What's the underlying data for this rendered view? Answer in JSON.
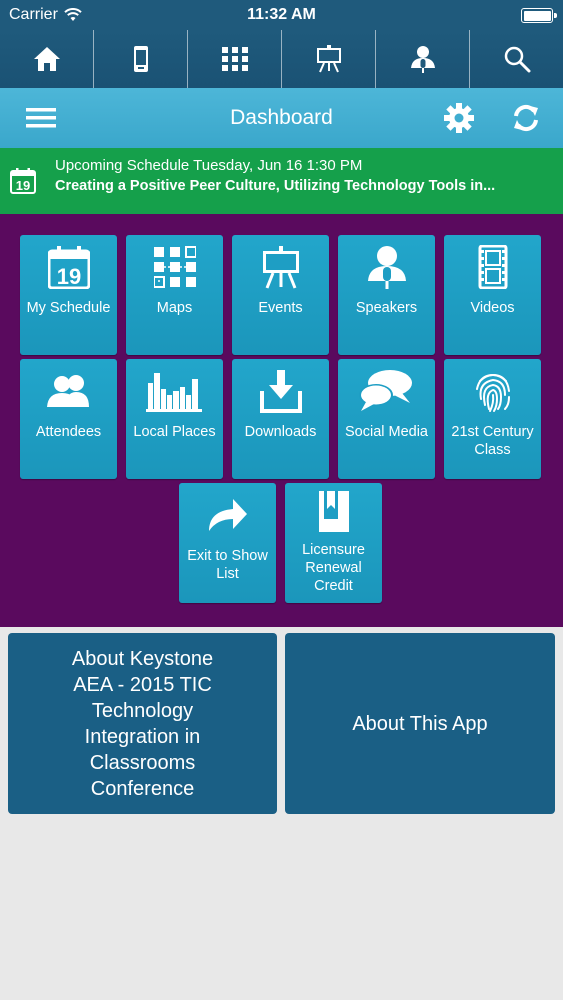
{
  "status_bar": {
    "carrier": "Carrier",
    "time": "11:32 AM"
  },
  "top_nav": [
    {
      "icon": "home-icon"
    },
    {
      "icon": "phone-icon"
    },
    {
      "icon": "map-grid-icon"
    },
    {
      "icon": "easel-icon"
    },
    {
      "icon": "speaker-icon"
    },
    {
      "icon": "search-icon"
    }
  ],
  "title_bar": {
    "title": "Dashboard"
  },
  "banner": {
    "day": "19",
    "line1": "Upcoming Schedule Tuesday, Jun 16 1:30 PM",
    "line2": "Creating a Positive Peer Culture, Utilizing Technology Tools in..."
  },
  "tiles": [
    {
      "label": "My Schedule",
      "icon": "calendar-icon",
      "day": "19"
    },
    {
      "label": "Maps",
      "icon": "map-grid-icon"
    },
    {
      "label": "Events",
      "icon": "easel-icon"
    },
    {
      "label": "Speakers",
      "icon": "speaker-icon"
    },
    {
      "label": "Videos",
      "icon": "film-icon"
    },
    {
      "label": "Attendees",
      "icon": "people-icon"
    },
    {
      "label": "Local Places",
      "icon": "city-icon"
    },
    {
      "label": "Downloads",
      "icon": "download-icon"
    },
    {
      "label": "Social Media",
      "icon": "chat-bubbles-icon"
    },
    {
      "label": "21st Century Class",
      "icon": "fingerprint-icon"
    },
    {
      "label": "Exit to Show List",
      "icon": "share-arrow-icon"
    },
    {
      "label": "Licensure Renewal Credit",
      "icon": "book-icon"
    }
  ],
  "info_buttons": [
    {
      "label": "About Keystone AEA - 2015 TIC Technology Integration in Classrooms Conference"
    },
    {
      "label": "About This App"
    }
  ],
  "colors": {
    "status_bar": "#1f5a7c",
    "title_bar": "#3aa7cb",
    "banner": "#15a04b",
    "grid_background": "#5a0a5e",
    "tile": "#1b96bb",
    "info_button": "#1a5f85"
  }
}
